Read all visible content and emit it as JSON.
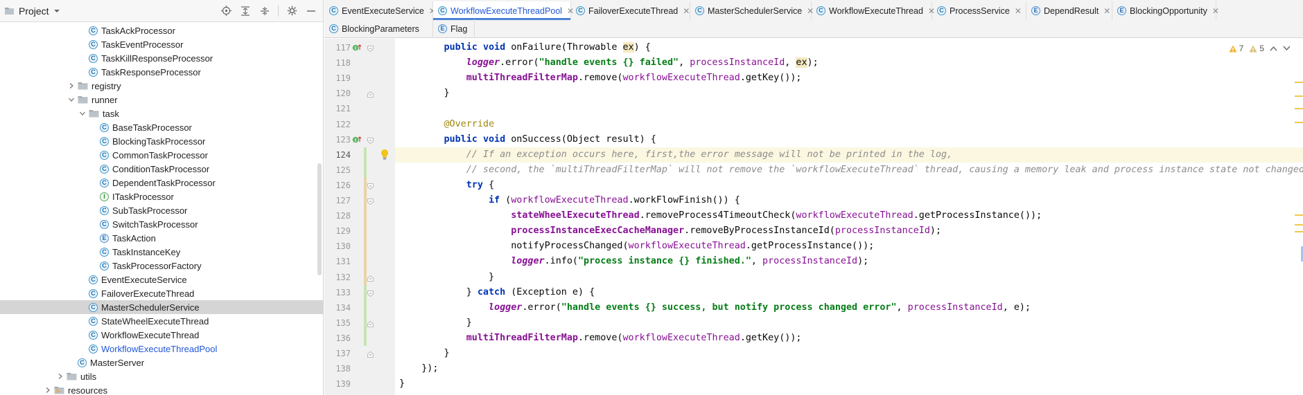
{
  "project_panel": {
    "title": "Project",
    "tree": [
      {
        "label": "TaskAckProcessor",
        "kind": "class",
        "indent": 4
      },
      {
        "label": "TaskEventProcessor",
        "kind": "class",
        "indent": 4
      },
      {
        "label": "TaskKillResponseProcessor",
        "kind": "class",
        "indent": 4
      },
      {
        "label": "TaskResponseProcessor",
        "kind": "class",
        "indent": 4
      },
      {
        "label": "registry",
        "kind": "folder",
        "indent": 3,
        "state": "collapsed"
      },
      {
        "label": "runner",
        "kind": "folder",
        "indent": 3,
        "state": "expanded"
      },
      {
        "label": "task",
        "kind": "folder",
        "indent": 4,
        "state": "expanded"
      },
      {
        "label": "BaseTaskProcessor",
        "kind": "class",
        "indent": 5
      },
      {
        "label": "BlockingTaskProcessor",
        "kind": "class",
        "indent": 5
      },
      {
        "label": "CommonTaskProcessor",
        "kind": "class",
        "indent": 5
      },
      {
        "label": "ConditionTaskProcessor",
        "kind": "class",
        "indent": 5
      },
      {
        "label": "DependentTaskProcessor",
        "kind": "class",
        "indent": 5
      },
      {
        "label": "ITaskProcessor",
        "kind": "interface",
        "indent": 5
      },
      {
        "label": "SubTaskProcessor",
        "kind": "class",
        "indent": 5
      },
      {
        "label": "SwitchTaskProcessor",
        "kind": "class",
        "indent": 5
      },
      {
        "label": "TaskAction",
        "kind": "enum",
        "indent": 5
      },
      {
        "label": "TaskInstanceKey",
        "kind": "class",
        "indent": 5
      },
      {
        "label": "TaskProcessorFactory",
        "kind": "class",
        "indent": 5
      },
      {
        "label": "EventExecuteService",
        "kind": "class",
        "indent": 4
      },
      {
        "label": "FailoverExecuteThread",
        "kind": "class",
        "indent": 4
      },
      {
        "label": "MasterSchedulerService",
        "kind": "class",
        "indent": 4,
        "selected": true
      },
      {
        "label": "StateWheelExecuteThread",
        "kind": "class",
        "indent": 4
      },
      {
        "label": "WorkflowExecuteThread",
        "kind": "class",
        "indent": 4
      },
      {
        "label": "WorkflowExecuteThreadPool",
        "kind": "class",
        "indent": 4,
        "link": true
      },
      {
        "label": "MasterServer",
        "kind": "class-main",
        "indent": 3
      },
      {
        "label": "utils",
        "kind": "folder",
        "indent": 2,
        "state": "collapsed"
      },
      {
        "label": "resources",
        "kind": "folder-res",
        "indent": 1,
        "state": "collapsed"
      }
    ]
  },
  "tabs": {
    "row1": [
      {
        "label": "EventExecuteService",
        "icon": "C"
      },
      {
        "label": "WorkflowExecuteThreadPool",
        "icon": "C",
        "active": true
      },
      {
        "label": "FailoverExecuteThread",
        "icon": "C"
      },
      {
        "label": "MasterSchedulerService",
        "icon": "C"
      },
      {
        "label": "WorkflowExecuteThread",
        "icon": "C"
      },
      {
        "label": "ProcessService",
        "icon": "C"
      },
      {
        "label": "DependResult",
        "icon": "E"
      },
      {
        "label": "BlockingOpportunity",
        "icon": "E"
      }
    ],
    "row2": [
      {
        "label": "BlockingParameters",
        "icon": "C"
      },
      {
        "label": "Flag",
        "icon": "E"
      }
    ]
  },
  "inspections": {
    "warnings": "7",
    "weak_warnings": "5"
  },
  "colors": {
    "accent": "#4a83d6",
    "keyword": "#0033b3",
    "string": "#067d17",
    "field": "#871094",
    "comment": "#8c8c8c",
    "annotation": "#9e880d"
  },
  "code": {
    "lines": [
      {
        "n": "117",
        "text": "        public void onFailure(Throwable ex) {",
        "gutter": "override"
      },
      {
        "n": "118",
        "text": "            logger.error(\"handle events {} failed\", processInstanceId, ex);"
      },
      {
        "n": "119",
        "text": "            multiThreadFilterMap.remove(workflowExecuteThread.getKey());"
      },
      {
        "n": "120",
        "text": "        }"
      },
      {
        "n": "121",
        "text": ""
      },
      {
        "n": "122",
        "text": "        @Override"
      },
      {
        "n": "123",
        "text": "        public void onSuccess(Object result) {",
        "gutter": "override"
      },
      {
        "n": "124",
        "text": "            // If an exception occurs here, first,the error message will not be printed in the log,",
        "current": true
      },
      {
        "n": "125",
        "text": "            // second, the `multiThreadFilterMap` will not remove the `workflowExecuteThread` thread, causing a memory leak and process instance state not changed"
      },
      {
        "n": "126",
        "text": "            try {"
      },
      {
        "n": "127",
        "text": "                if (workflowExecuteThread.workFlowFinish()) {"
      },
      {
        "n": "128",
        "text": "                    stateWheelExecuteThread.removeProcess4TimeoutCheck(workflowExecuteThread.getProcessInstance());"
      },
      {
        "n": "129",
        "text": "                    processInstanceExecCacheManager.removeByProcessInstanceId(processInstanceId);"
      },
      {
        "n": "130",
        "text": "                    notifyProcessChanged(workflowExecuteThread.getProcessInstance());"
      },
      {
        "n": "131",
        "text": "                    logger.info(\"process instance {} finished.\", processInstanceId);"
      },
      {
        "n": "132",
        "text": "                }"
      },
      {
        "n": "133",
        "text": "            } catch (Exception e) {"
      },
      {
        "n": "134",
        "text": "                logger.error(\"handle events {} success, but notify process changed error\", processInstanceId, e);"
      },
      {
        "n": "135",
        "text": "            }"
      },
      {
        "n": "136",
        "text": "            multiThreadFilterMap.remove(workflowExecuteThread.getKey());"
      },
      {
        "n": "137",
        "text": "        }"
      },
      {
        "n": "138",
        "text": "    });"
      },
      {
        "n": "139",
        "text": "}"
      }
    ]
  }
}
